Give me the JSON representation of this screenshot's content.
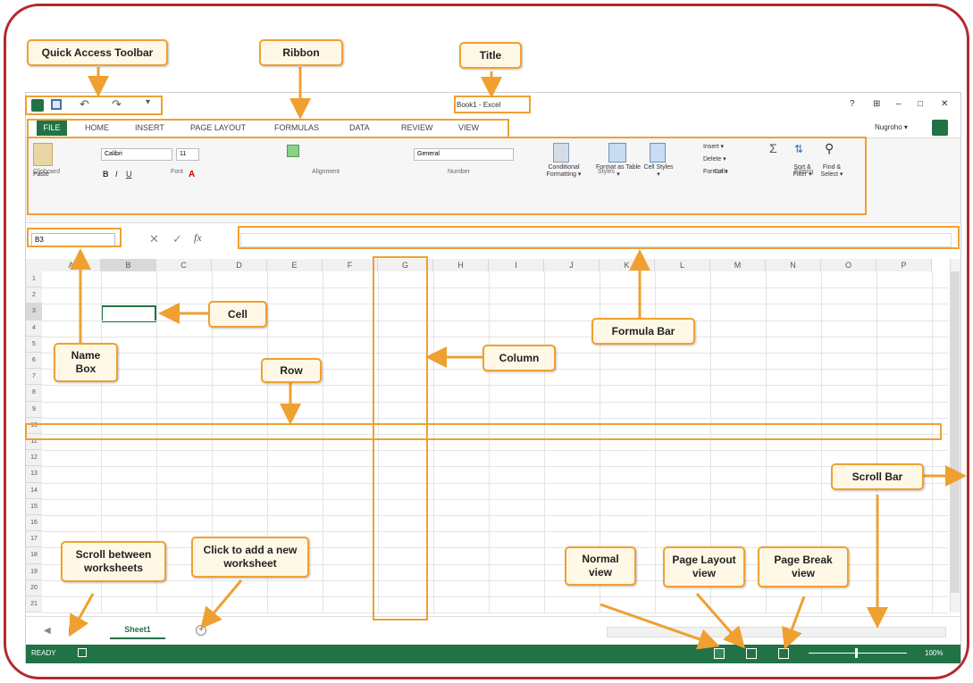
{
  "title_bar": {
    "title": "Book1 - Excel",
    "window_controls": [
      "?",
      "⊞",
      "–",
      "□",
      "✕"
    ]
  },
  "qat": {
    "undo": "↶",
    "redo": "↷"
  },
  "ribbon": {
    "tabs": [
      "FILE",
      "HOME",
      "INSERT",
      "PAGE LAYOUT",
      "FORMULAS",
      "DATA",
      "REVIEW",
      "VIEW"
    ],
    "user": "Nugroho ▾",
    "groups": [
      "Clipboard",
      "Font",
      "Alignment",
      "Number",
      "Styles",
      "Cells",
      "Editing"
    ],
    "clipboard": {
      "paste": "Paste"
    },
    "font": {
      "name": "Calibri",
      "size": "11"
    },
    "number": {
      "format": "General"
    },
    "styles": {
      "conditional": "Conditional Formatting ▾",
      "format_table": "Format as Table ▾",
      "cell_styles": "Cell Styles ▾"
    },
    "cells": {
      "insert": "Insert ▾",
      "delete": "Delete ▾",
      "format": "Format ▾"
    },
    "editing": {
      "sort": "Sort & Filter ▾",
      "find": "Find & Select ▾"
    }
  },
  "formula_bar": {
    "name_box": "B3",
    "fx": "fx"
  },
  "columns": [
    "A",
    "B",
    "C",
    "D",
    "E",
    "F",
    "G",
    "H",
    "I",
    "J",
    "K",
    "L",
    "M",
    "N",
    "O",
    "P"
  ],
  "rows": [
    "1",
    "2",
    "3",
    "4",
    "5",
    "6",
    "7",
    "8",
    "9",
    "10",
    "11",
    "12",
    "13",
    "14",
    "15",
    "16",
    "17",
    "18",
    "19",
    "20",
    "21"
  ],
  "sheet_tab": "Sheet1",
  "status": {
    "ready": "READY",
    "zoom": "100%"
  },
  "annotations": {
    "quick_access": "Quick Access Toolbar",
    "ribbon": "Ribbon",
    "title": "Title",
    "cell": "Cell",
    "name_box": "Name Box",
    "formula_bar": "Formula Bar",
    "column": "Column",
    "row": "Row",
    "scroll_bar": "Scroll Bar",
    "scroll_sheets": "Scroll between worksheets",
    "add_sheet": "Click to add a new worksheet",
    "normal_view": "Normal view",
    "page_layout_view": "Page Layout view",
    "page_break_view": "Page Break view"
  },
  "colors": {
    "excel_green": "#217346",
    "highlight": "#f0a030",
    "frame": "#b22a2e"
  }
}
